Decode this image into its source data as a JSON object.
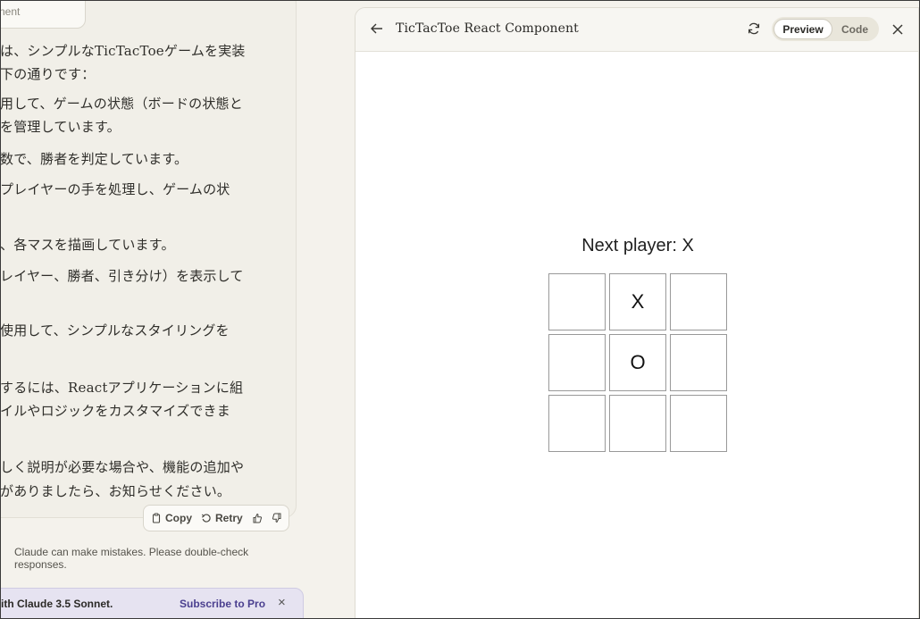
{
  "chat": {
    "attachment_label": "nent",
    "lines": [
      "は、シンプルなTicTacToeゲームを実装",
      "下の通りです：",
      "用して、ゲームの状態（ボードの状態と",
      "を管理しています。",
      "数で、勝者を判定しています。",
      "プレイヤーの手を処理し、ゲームの状",
      "、各マスを描画しています。",
      "レイヤー、勝者、引き分け）を表示して",
      "使用して、シンプルなスタイリングを",
      "するには、Reactアプリケーションに組",
      "イルやロジックをカスタマイズできま",
      "しく説明が必要な場合や、機能の追加や",
      "がありましたら、お知らせください。"
    ],
    "actions": {
      "copy": "Copy",
      "retry": "Retry"
    },
    "disclaimer": "Claude can make mistakes. Please double-check responses.",
    "promo": {
      "text": "ith Claude 3.5 Sonnet.",
      "link": "Subscribe to Pro",
      "close": "×"
    }
  },
  "artifact": {
    "title": "TicTacToe React Component",
    "tabs": {
      "preview": "Preview",
      "code": "Code"
    },
    "status": "Next player: X",
    "board": [
      [
        "",
        "X",
        ""
      ],
      [
        "",
        "O",
        ""
      ],
      [
        "",
        "",
        ""
      ]
    ]
  }
}
